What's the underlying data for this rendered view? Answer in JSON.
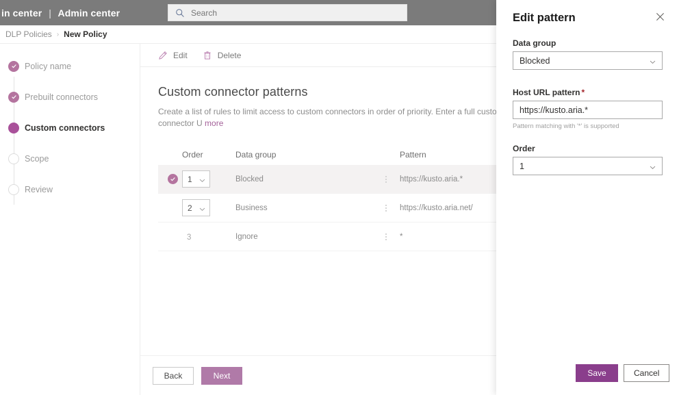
{
  "suitebar": {
    "brand_truncated": "in center",
    "separator": "|",
    "app_name": "Admin center",
    "search": {
      "placeholder": "Search",
      "icon": "search-icon"
    }
  },
  "breadcrumb": {
    "parent": "DLP Policies",
    "separator": "›",
    "current": "New Policy"
  },
  "wizard": {
    "steps": [
      {
        "label": "Policy name",
        "state": "done"
      },
      {
        "label": "Prebuilt connectors",
        "state": "done"
      },
      {
        "label": "Custom connectors",
        "state": "active"
      },
      {
        "label": "Scope",
        "state": "todo"
      },
      {
        "label": "Review",
        "state": "todo"
      }
    ],
    "footer": {
      "back_label": "Back",
      "next_label": "Next"
    }
  },
  "commandbar": {
    "edit_label": "Edit",
    "delete_label": "Delete"
  },
  "main": {
    "title": "Custom connector patterns",
    "description": "Create a list of rules to limit access to custom connectors in order of priority. Enter a full custom connector U",
    "more_label": "more",
    "table": {
      "columns": [
        "Order",
        "Data group",
        "Pattern"
      ],
      "rows": [
        {
          "selected": true,
          "order": "1",
          "order_is_select": true,
          "data_group": "Blocked",
          "pattern": "https://kusto.aria.*"
        },
        {
          "selected": false,
          "order": "2",
          "order_is_select": true,
          "data_group": "Business",
          "pattern": "https://kusto.aria.net/"
        },
        {
          "selected": false,
          "order": "3",
          "order_is_select": false,
          "data_group": "Ignore",
          "pattern": "*"
        }
      ]
    }
  },
  "flyout": {
    "title": "Edit pattern",
    "close_icon": "close-icon",
    "fields": {
      "data_group": {
        "label": "Data group",
        "value": "Blocked",
        "required": false
      },
      "host_url_pattern": {
        "label": "Host URL pattern",
        "required_mark": "*",
        "value": "https://kusto.aria.*",
        "hint": "Pattern matching with '*' is supported"
      },
      "order": {
        "label": "Order",
        "value": "1",
        "required": false
      }
    },
    "footer": {
      "save_label": "Save",
      "cancel_label": "Cancel"
    }
  },
  "colors": {
    "suitebar_bg": "#7b7b7b",
    "accent_purple": "#8a3e8c",
    "accent_muted": "#b07aa8",
    "step_done": "#b4749f",
    "step_active": "#a9519a",
    "link": "#a4629a",
    "required_red": "#a4262c"
  }
}
